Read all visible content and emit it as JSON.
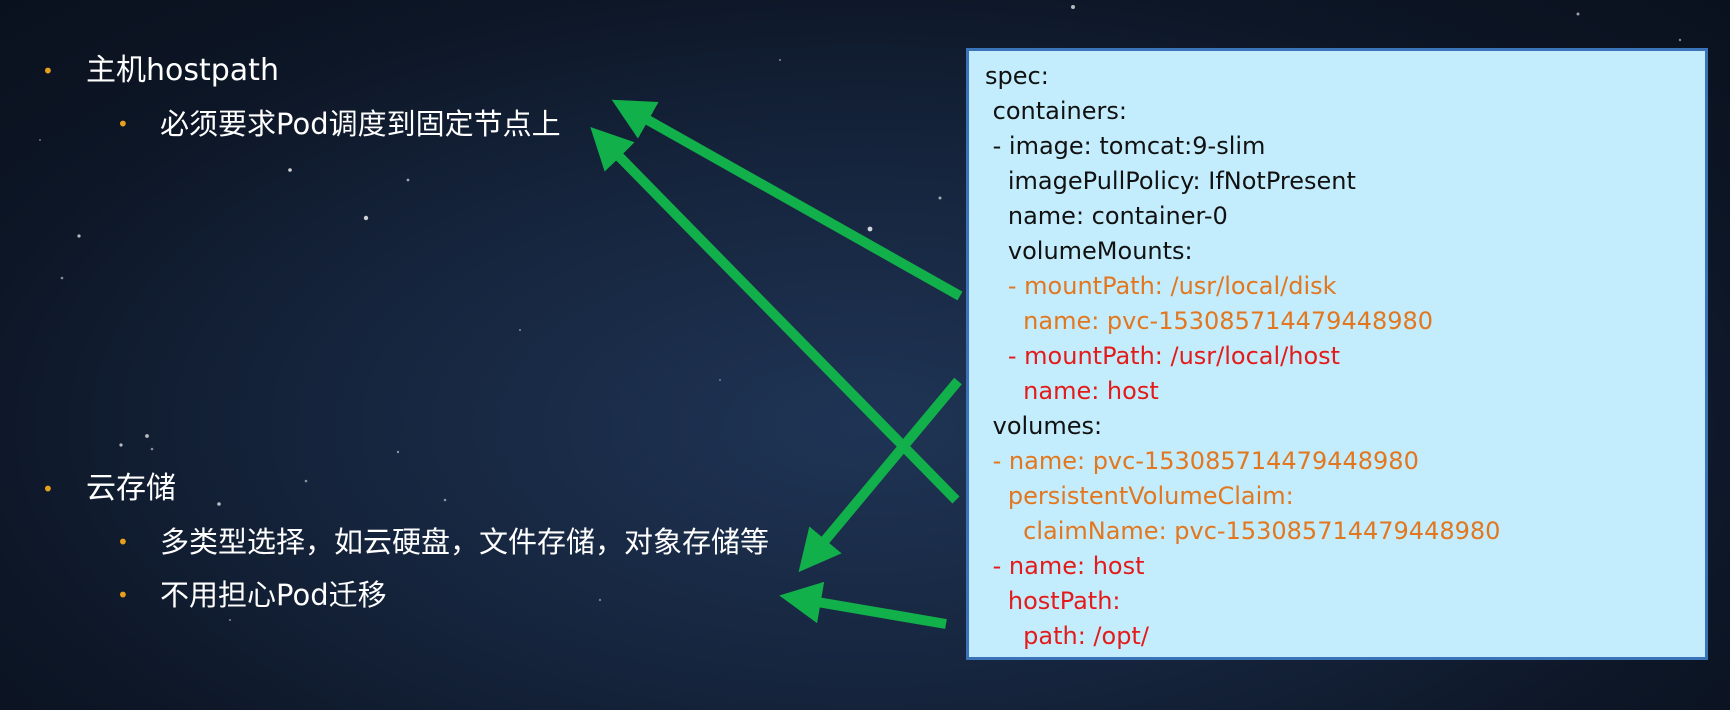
{
  "left_bullets": {
    "hostpath": "主机hostpath",
    "hostpath_sub": "必须要求Pod调度到固定节点上",
    "cloud": "云存储",
    "cloud_sub1": "多类型选择，如云硬盘，文件存储，对象存储等",
    "cloud_sub2": "不用担心Pod迁移",
    "bullet_glyph": "•",
    "bullet_color": "#e6a01e"
  },
  "code": {
    "lines": [
      {
        "text": "spec:",
        "color": "black"
      },
      {
        "text": " containers:",
        "color": "black"
      },
      {
        "text": " - image: tomcat:9-slim",
        "color": "black"
      },
      {
        "text": "   imagePullPolicy: IfNotPresent",
        "color": "black"
      },
      {
        "text": "   name: container-0",
        "color": "black"
      },
      {
        "text": "   volumeMounts:",
        "color": "black"
      },
      {
        "text": "   - mountPath: /usr/local/disk",
        "color": "orange"
      },
      {
        "text": "     name: pvc-153085714479448980",
        "color": "orange"
      },
      {
        "text": "   - mountPath: /usr/local/host",
        "color": "red"
      },
      {
        "text": "     name: host",
        "color": "red"
      },
      {
        "text": " volumes:",
        "color": "black"
      },
      {
        "text": " - name: pvc-153085714479448980",
        "color": "orange"
      },
      {
        "text": "   persistentVolumeClaim:",
        "color": "orange"
      },
      {
        "text": "     claimName: pvc-153085714479448980",
        "color": "orange"
      },
      {
        "text": " - name: host",
        "color": "red"
      },
      {
        "text": "   hostPath:",
        "color": "red"
      },
      {
        "text": "     path: /opt/",
        "color": "red"
      }
    ],
    "colors": {
      "black": "#111111",
      "orange": "#e2771f",
      "red": "#e41b1b",
      "box_background": "#c3edfc",
      "box_border": "#3b73b9"
    }
  },
  "arrow_color": "#12b04a"
}
